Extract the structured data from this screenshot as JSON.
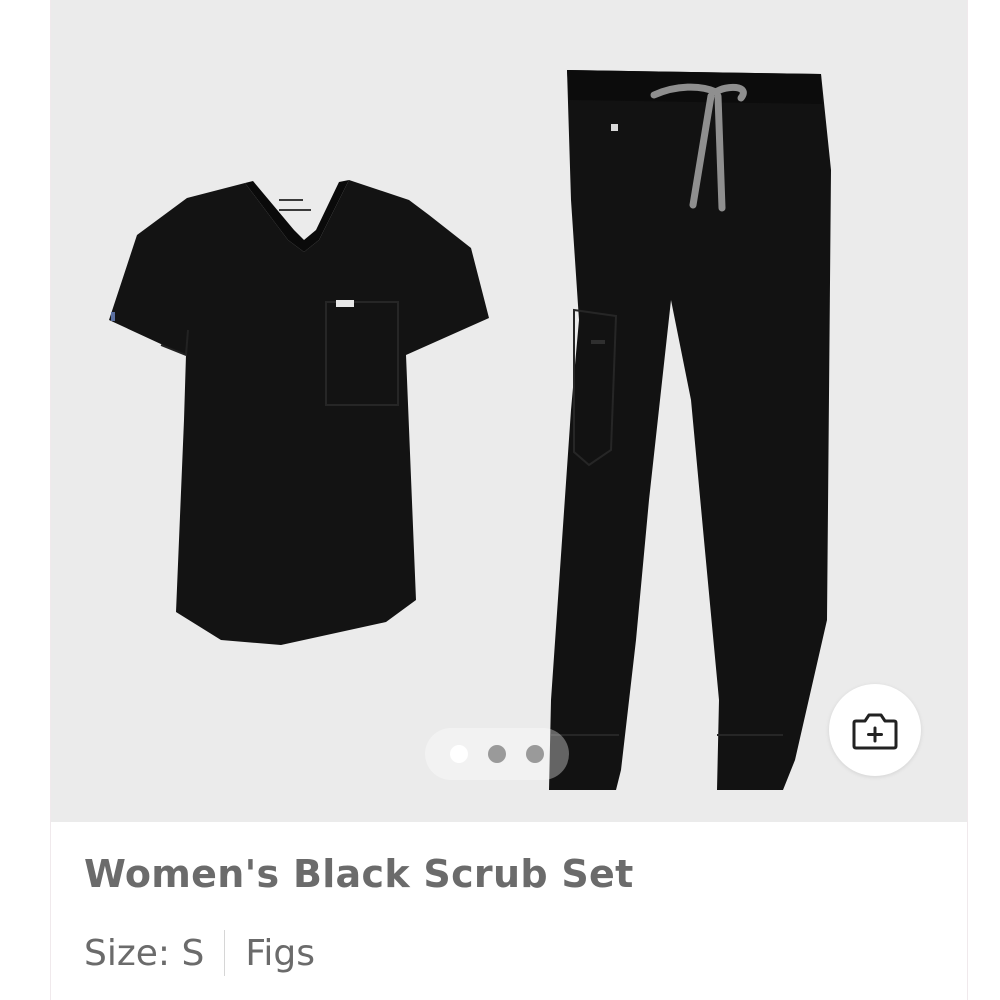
{
  "product": {
    "title": "Women's Black Scrub Set",
    "size_label": "Size: S",
    "brand": "Figs",
    "photo_background": "#ebebeb"
  },
  "gallery": {
    "image_count": 3,
    "active_index": 0,
    "add_photo_icon": "camera-plus-icon"
  }
}
